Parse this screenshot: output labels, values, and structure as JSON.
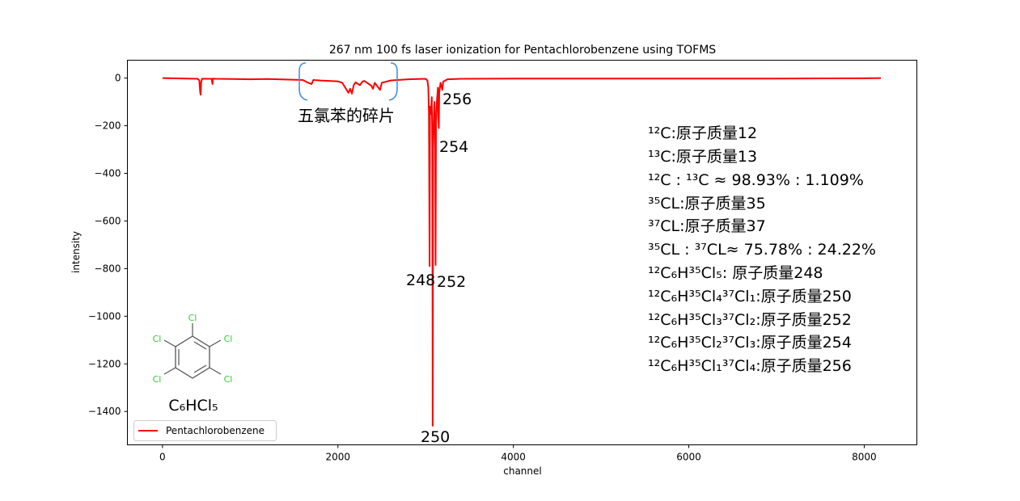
{
  "chart_data": {
    "type": "line",
    "title": "267 nm 100 fs laser ionization for Pentachlorobenzene using TOFMS",
    "xlabel": "channel",
    "ylabel": "intensity",
    "xlim": [
      -400,
      8600
    ],
    "ylim": [
      -1540,
      75
    ],
    "xticks": [
      0,
      2000,
      4000,
      6000,
      8000
    ],
    "xtick_labels": [
      "0",
      "2000",
      "4000",
      "6000",
      "8000"
    ],
    "yticks": [
      0,
      -200,
      -400,
      -600,
      -800,
      -1000,
      -1200,
      -1400
    ],
    "ytick_labels": [
      "0",
      "−200",
      "−400",
      "−600",
      "−800",
      "−1000",
      "−1200",
      "−1400"
    ],
    "grid": false,
    "legend_position": "lower-left",
    "series": [
      {
        "name": "Pentachlorobenzene",
        "color": "#ff0000",
        "points": [
          [
            0,
            0
          ],
          [
            400,
            -3
          ],
          [
            420,
            -10
          ],
          [
            430,
            -60
          ],
          [
            435,
            -70
          ],
          [
            440,
            -20
          ],
          [
            450,
            -3
          ],
          [
            560,
            -3
          ],
          [
            570,
            -25
          ],
          [
            575,
            -2
          ],
          [
            600,
            -3
          ],
          [
            800,
            -4
          ],
          [
            1000,
            -5
          ],
          [
            1200,
            -4
          ],
          [
            1400,
            -6
          ],
          [
            1600,
            -8
          ],
          [
            1650,
            -18
          ],
          [
            1700,
            -25
          ],
          [
            1720,
            -8
          ],
          [
            1800,
            -10
          ],
          [
            1900,
            -12
          ],
          [
            2000,
            -14
          ],
          [
            2050,
            -20
          ],
          [
            2100,
            -50
          ],
          [
            2120,
            -62
          ],
          [
            2140,
            -45
          ],
          [
            2160,
            -65
          ],
          [
            2180,
            -30
          ],
          [
            2200,
            -18
          ],
          [
            2250,
            -30
          ],
          [
            2280,
            -15
          ],
          [
            2300,
            -12
          ],
          [
            2380,
            -32
          ],
          [
            2400,
            -45
          ],
          [
            2420,
            -20
          ],
          [
            2460,
            -40
          ],
          [
            2480,
            -50
          ],
          [
            2500,
            -20
          ],
          [
            2600,
            -10
          ],
          [
            2800,
            -5
          ],
          [
            3000,
            -3
          ],
          [
            3020,
            -10
          ],
          [
            3030,
            -40
          ],
          [
            3038,
            -150
          ],
          [
            3045,
            -790
          ],
          [
            3050,
            -120
          ],
          [
            3060,
            -150
          ],
          [
            3070,
            -80
          ],
          [
            3076,
            -300
          ],
          [
            3080,
            -1460
          ],
          [
            3085,
            -300
          ],
          [
            3095,
            -150
          ],
          [
            3100,
            -100
          ],
          [
            3108,
            -200
          ],
          [
            3113,
            -785
          ],
          [
            3118,
            -200
          ],
          [
            3128,
            -100
          ],
          [
            3140,
            -40
          ],
          [
            3145,
            -160
          ],
          [
            3150,
            -210
          ],
          [
            3155,
            -60
          ],
          [
            3170,
            -20
          ],
          [
            3190,
            -50
          ],
          [
            3200,
            -15
          ],
          [
            3250,
            -5
          ],
          [
            3400,
            -3
          ],
          [
            4000,
            -2
          ],
          [
            5000,
            -2
          ],
          [
            6000,
            -2
          ],
          [
            7000,
            -2
          ],
          [
            8000,
            -1
          ],
          [
            8190,
            0
          ]
        ]
      }
    ],
    "annotations": {
      "fragment_text": "五氯苯的碎片",
      "peak_labels": [
        "256",
        "254",
        "248",
        "252",
        "250"
      ],
      "isotope_lines": [
        "¹²C:原子质量12",
        "¹³C:原子质量13",
        "¹²C : ¹³C ≈ 98.93% : 1.109%",
        "³⁵CL:原子质量35",
        "³⁷CL:原子质量37",
        "³⁵CL : ³⁷CL≈ 75.78% : 24.22%",
        "¹²C₆H³⁵Cl₅:       原子质量248",
        "¹²C₆H³⁵Cl₄³⁷Cl₁:原子质量250",
        "¹²C₆H³⁵Cl₃³⁷Cl₂:原子质量252",
        "¹²C₆H³⁵Cl₂³⁷Cl₃:原子质量254",
        "¹²C₆H³⁵Cl₁³⁷Cl₄:原子质量256"
      ],
      "molecule_formula": "C₆HCl₅",
      "molecule_atoms": [
        "Cl",
        "Cl",
        "Cl",
        "Cl",
        "Cl"
      ]
    }
  }
}
